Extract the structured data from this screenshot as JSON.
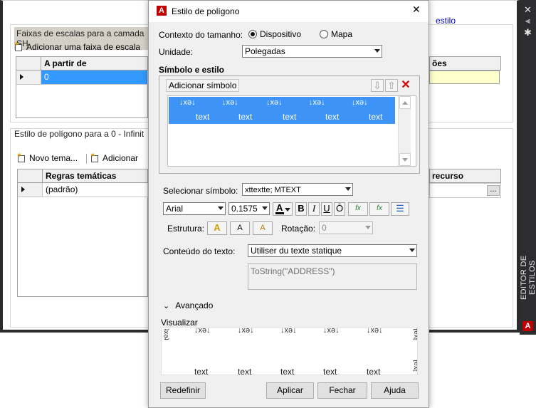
{
  "colors": {
    "accent": "#3d94f6",
    "brand_red": "#c00000",
    "selection": "#3399ff",
    "link": "#0000cc",
    "highlight_yellow": "#ffffcc"
  },
  "background": {
    "link_fragment": "estilo",
    "scales_section": {
      "label": "Faixas de escalas para a camada SH",
      "add_button": "Adicionar uma faixa de escala",
      "headers": [
        "A partir de",
        "ões"
      ],
      "row_value": "0"
    },
    "style_section": {
      "label": "Estilo de polígono para a 0 - Infinit",
      "new_theme_button": "Novo tema...",
      "add_button": "Adicionar",
      "headers": [
        "Regras temáticas",
        "recurso"
      ],
      "row_value": "(padrão)",
      "ellipsis": "..."
    },
    "side_panel_label": "EDITOR DE ESTILOS",
    "side_icons": [
      "close-icon",
      "pin-icon",
      "settings-icon"
    ]
  },
  "dialog": {
    "title": "Estilo de polígono",
    "close_glyph": "✕",
    "size_context": {
      "label": "Contexto do tamanho:",
      "option_device": "Dispositivo",
      "option_map": "Mapa",
      "selected": "Dispositivo"
    },
    "unit": {
      "label": "Unidade:",
      "value": "Polegadas"
    },
    "symbol_style": {
      "title": "Símbolo e estilo",
      "add_symbol_button": "Adicionar símbolo",
      "symbol_glyph": "↓xǝ↓",
      "symbol_text": "text"
    },
    "select_symbol": {
      "label": "Selecionar símbolo:",
      "value": "xttextte; MTEXT"
    },
    "font": {
      "family": "Arial",
      "size": "0.1575",
      "bold": "B",
      "italic": "I",
      "underline": "U",
      "overline": "Ō",
      "fx": "fx"
    },
    "structure": {
      "label": "Estrutura:"
    },
    "rotation": {
      "label": "Rotação:",
      "value": "0"
    },
    "text_content": {
      "label": "Conteúdo do texto:",
      "value": "Utiliser du texte statique",
      "expression": "ToString(\"ADDRESS\")"
    },
    "advanced": {
      "label": "Avançado"
    },
    "preview": {
      "label": "Visualizar",
      "top_glyph": "↓xǝ↓",
      "bottom_text": "text",
      "side_glyph": "ʇxǝʇ"
    },
    "buttons": {
      "reset": "Redefinir",
      "apply": "Aplicar",
      "close": "Fechar",
      "help": "Ajuda"
    }
  }
}
